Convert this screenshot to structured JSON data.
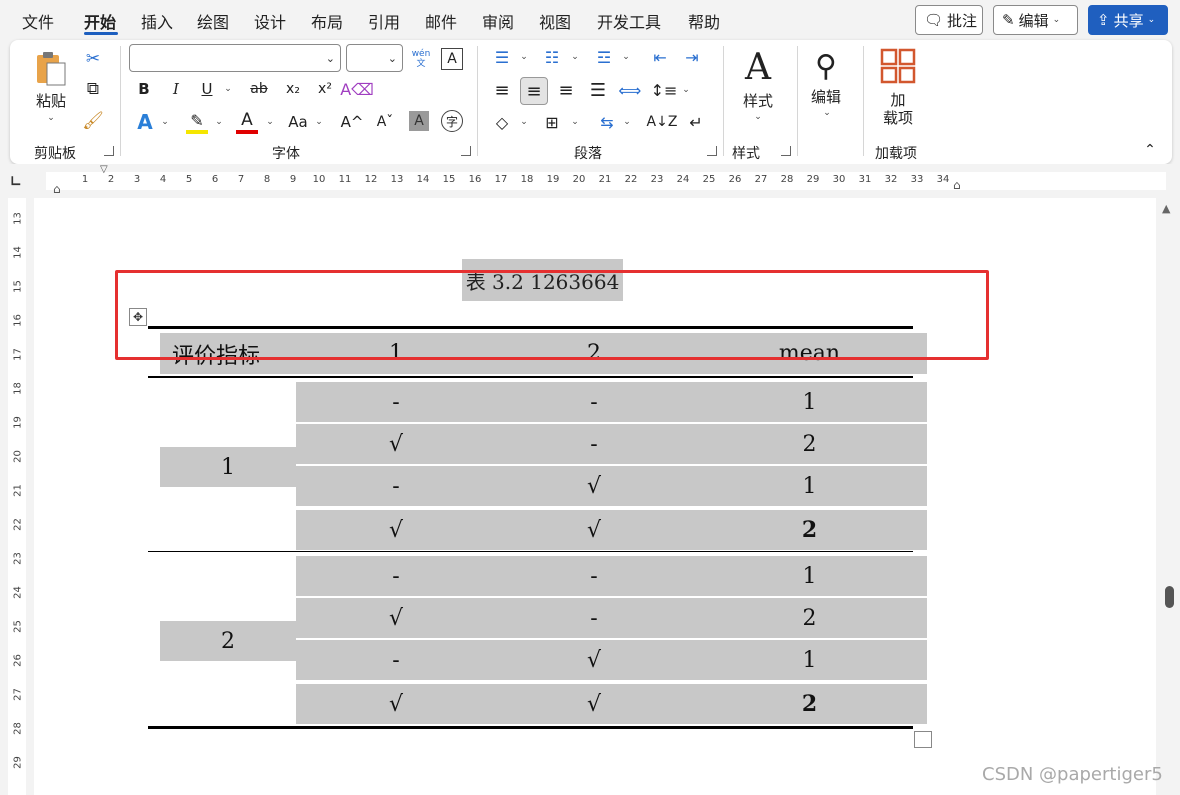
{
  "menu": {
    "tabs": [
      "文件",
      "开始",
      "插入",
      "绘图",
      "设计",
      "布局",
      "引用",
      "邮件",
      "审阅",
      "视图",
      "开发工具",
      "帮助"
    ],
    "active": "开始",
    "comment_btn": "批注",
    "edit_btn": "编辑",
    "share_btn": "共享"
  },
  "ribbon": {
    "clipboard": {
      "paste_label": "粘贴",
      "group_label": "剪贴板"
    },
    "font": {
      "group_label": "字体",
      "bold": "B",
      "italic": "I",
      "underline": "U",
      "strike": "ab",
      "subscript": "x₂",
      "superscript": "x²",
      "change_case": "Aa",
      "grow": "A^",
      "shrink": "Aˇ",
      "phonetic": "wén 文",
      "char_border": "A",
      "char_shading": "A",
      "enclose": "字"
    },
    "paragraph": {
      "group_label": "段落"
    },
    "styles": {
      "label": "样式",
      "group_label": "样式"
    },
    "editing": {
      "label": "编辑"
    },
    "addins": {
      "label_line1": "加",
      "label_line2": "载项",
      "group_label": "加载项"
    }
  },
  "ruler": {
    "h_numbers": [
      "1",
      "1",
      "2",
      "3",
      "4",
      "5",
      "6",
      "7",
      "8",
      "9",
      "10",
      "11",
      "12",
      "13",
      "14",
      "15",
      "16",
      "17",
      "18",
      "19",
      "20",
      "21",
      "22",
      "23",
      "24",
      "25",
      "26",
      "27",
      "28",
      "29",
      "30",
      "31",
      "32",
      "33",
      "34"
    ],
    "v_numbers": [
      "13",
      "14",
      "15",
      "16",
      "17",
      "18",
      "19",
      "20",
      "21",
      "22",
      "23",
      "24",
      "25",
      "26",
      "27",
      "28",
      "29"
    ]
  },
  "document": {
    "caption": "表 3.2 1263664",
    "table": {
      "headers": [
        "评价指标",
        "1",
        "2",
        "mean"
      ],
      "groups": [
        {
          "label": "1",
          "rows": [
            [
              "-",
              "-",
              "1"
            ],
            [
              "√",
              "-",
              "2"
            ],
            [
              "-",
              "√",
              "1"
            ],
            [
              "√",
              "√",
              "2"
            ]
          ]
        },
        {
          "label": "2",
          "rows": [
            [
              "-",
              "-",
              "1"
            ],
            [
              "√",
              "-",
              "2"
            ],
            [
              "-",
              "√",
              "1"
            ],
            [
              "√",
              "√",
              "2"
            ]
          ]
        }
      ]
    }
  },
  "watermark": "CSDN @papertiger5",
  "colors": {
    "accent": "#1d5fbf",
    "highlight": "#c8c8c8",
    "annotation": "#e53030"
  }
}
